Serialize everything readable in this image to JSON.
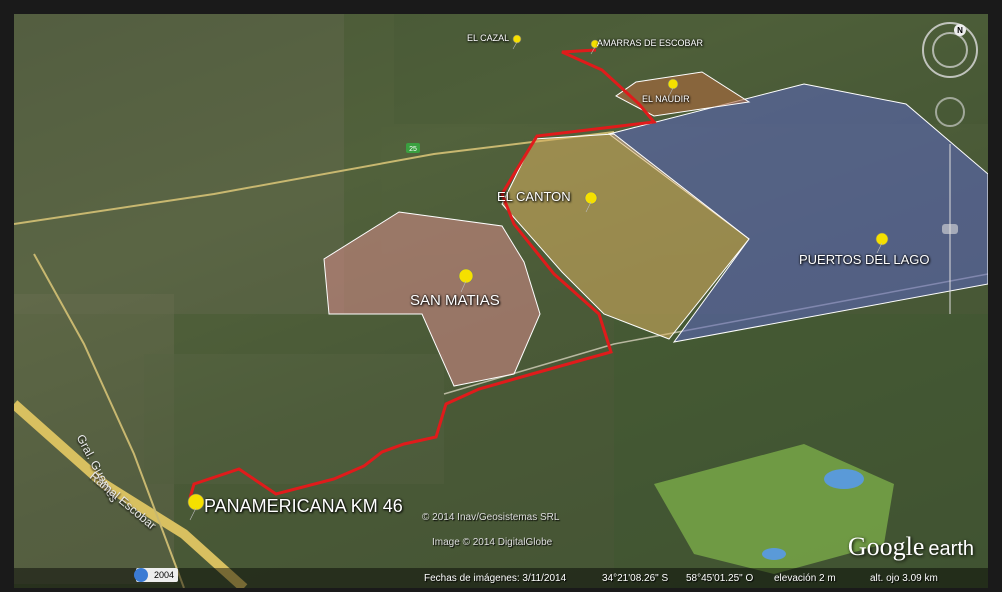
{
  "places": {
    "el_cazal": "EL CAZAL",
    "amarras": "AMARRAS DE ESCOBAR",
    "el_naudir": "EL NAUDIR",
    "el_canton": "EL CANTON",
    "puertos": "PUERTOS DEL LAGO",
    "san_matias": "SAN MATIAS",
    "panamericana": "PANAMERICANA KM 46"
  },
  "roads": {
    "route_shield": "25",
    "gral_guemes": "Gral. Guemes",
    "ramal_escobar": "Ramal Escobar"
  },
  "attribution": {
    "line1": "© 2014 Inav/Geosistemas SRL",
    "line2": "Image © 2014 DigitalGlobe"
  },
  "brand": {
    "google": "Google",
    "earth": "earth"
  },
  "status": {
    "year": "2004",
    "imagery_date": "Fechas de imágenes: 3/11/2014",
    "lat": "34°21'08.26\" S",
    "lon": "58°45'01.25\" O",
    "elevation": "elevación    2 m",
    "eye_alt": "alt. ojo   3.09 km"
  },
  "compass": {
    "north": "N"
  },
  "colors": {
    "route": "#e01b1b",
    "san_matias": "#d98c8c",
    "el_canton": "#d9b060",
    "puertos": "#5a66b8",
    "el_naudir": "#b06a40",
    "pin": "#f5e000"
  },
  "icons": {
    "placemark": "pushpin-icon",
    "compass": "compass-icon",
    "year": "time-slider-icon"
  }
}
